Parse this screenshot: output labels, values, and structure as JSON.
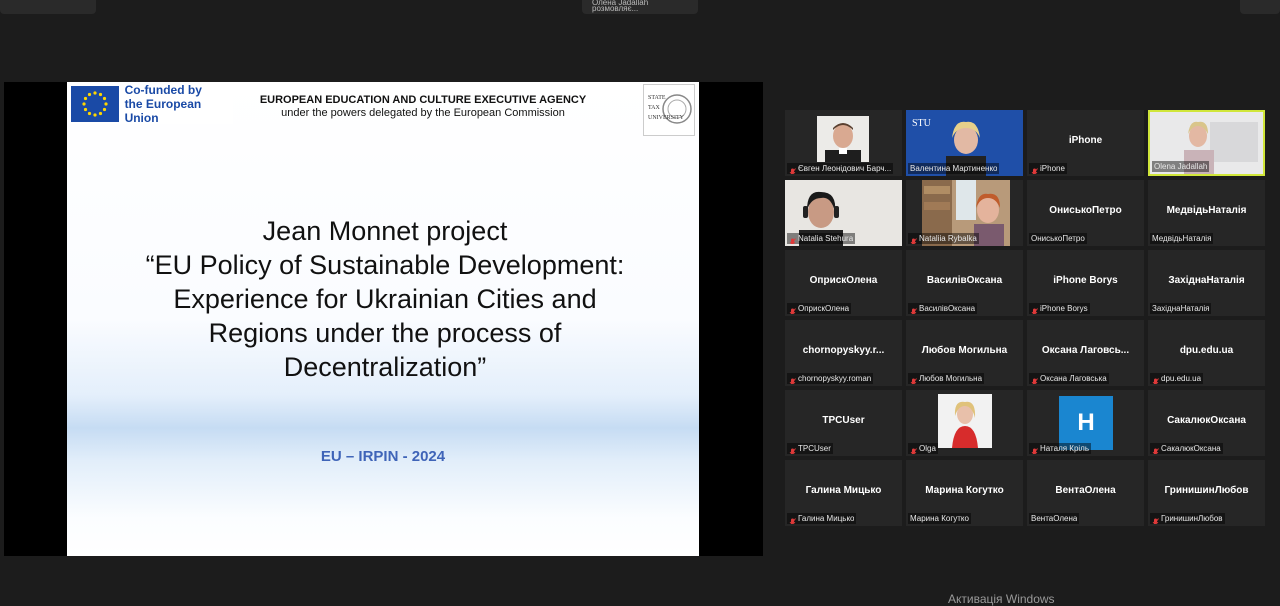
{
  "top_bar": {
    "speaker_label": "Олена Jadallah розмовляє..."
  },
  "slide": {
    "eu_logo_text": [
      "Co-funded by",
      "the European Union"
    ],
    "agency_line1": "EUROPEAN EDUCATION AND CULTURE EXECUTIVE AGENCY",
    "agency_line2": "under the powers delegated by the European Commission",
    "university_logo": [
      "STATE",
      "TAX",
      "UNIVERSITY"
    ],
    "title_lines": [
      "Jean Monnet project",
      "“EU Policy of Sustainable Development:",
      "Experience for Ukrainian Cities and",
      "Regions under the process of",
      "Decentralization”"
    ],
    "footer": "EU – IRPIN - 2024"
  },
  "participants": [
    {
      "center": "",
      "label": "Євген Леонідович Барч...",
      "muted": true,
      "video": "man"
    },
    {
      "center": "",
      "label": "Валентина Мартиненко",
      "muted": false,
      "video": "woman-blue"
    },
    {
      "center": "iPhone",
      "label": "iPhone",
      "muted": true
    },
    {
      "center": "",
      "label": "Olena Jadallah",
      "muted": false,
      "video": "woman-light",
      "active": true
    },
    {
      "center": "",
      "label": "Natalia Stehura",
      "muted": true,
      "video": "woman-headset"
    },
    {
      "center": "",
      "label": "Nataliia Rybalka",
      "muted": true,
      "video": "woman-red"
    },
    {
      "center": "ОниськоПетро",
      "label": "ОниськоПетро",
      "muted": false
    },
    {
      "center": "МедвідьНаталія",
      "label": "МедвідьНаталія",
      "muted": false
    },
    {
      "center": "ОприскОлена",
      "label": "ОприскОлена",
      "muted": true
    },
    {
      "center": "ВасилівОксана",
      "label": "ВасилівОксана",
      "muted": true
    },
    {
      "center": "iPhone Borys",
      "label": "iPhone Borys",
      "muted": true
    },
    {
      "center": "ЗахіднаНаталія",
      "label": "ЗахіднаНаталія",
      "muted": false
    },
    {
      "center": "chornopyskyy.r...",
      "label": "chornopyskyy.roman",
      "muted": true
    },
    {
      "center": "Любов Могильна",
      "label": "Любов Могильна",
      "muted": true
    },
    {
      "center": "Оксана  Лаговсь...",
      "label": "Оксана Лаговська",
      "muted": true
    },
    {
      "center": "dpu.edu.ua",
      "label": "dpu.edu.ua",
      "muted": true
    },
    {
      "center": "TPCUser",
      "label": "TPCUser",
      "muted": true
    },
    {
      "center": "",
      "label": "Olga",
      "muted": true,
      "video": "olga"
    },
    {
      "center": "",
      "label": "Наталя Кріль",
      "muted": true,
      "video": "h-avatar",
      "avatar_letter": "H"
    },
    {
      "center": "СакалюкОксана",
      "label": "СакалюкОксана",
      "muted": true
    },
    {
      "center": "Галина Мицько",
      "label": "Галина Мицько",
      "muted": true
    },
    {
      "center": "Марина Когутко",
      "label": "Марина Когутко",
      "muted": false
    },
    {
      "center": "ВентаОлена",
      "label": "ВентаОлена",
      "muted": false
    },
    {
      "center": "ГринишинЛюбов",
      "label": "ГринишинЛюбов",
      "muted": true
    }
  ],
  "windows_watermark": "Активація Windows"
}
